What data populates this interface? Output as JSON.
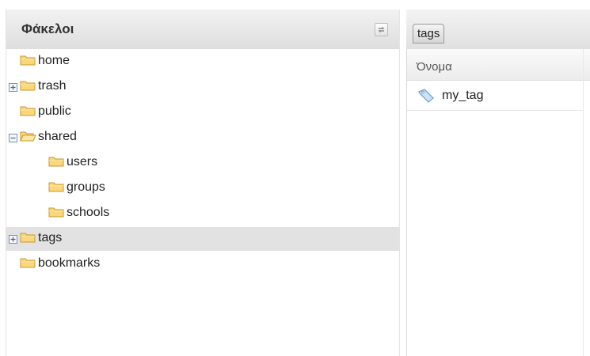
{
  "folders_panel": {
    "title": "Φάκελοι",
    "refresh_icon": "refresh-icon",
    "tree": [
      {
        "label": "home",
        "icon": "folder-icon",
        "expander": null,
        "depth": 0,
        "selected": false
      },
      {
        "label": "trash",
        "icon": "folder-icon",
        "expander": "expand",
        "depth": 0,
        "selected": false
      },
      {
        "label": "public",
        "icon": "folder-icon",
        "expander": null,
        "depth": 0,
        "selected": false
      },
      {
        "label": "shared",
        "icon": "folder-open-icon",
        "expander": "collapse",
        "depth": 0,
        "selected": false
      },
      {
        "label": "users",
        "icon": "folder-icon",
        "expander": null,
        "depth": 1,
        "selected": false
      },
      {
        "label": "groups",
        "icon": "folder-icon",
        "expander": null,
        "depth": 1,
        "selected": false
      },
      {
        "label": "schools",
        "icon": "folder-icon",
        "expander": null,
        "depth": 1,
        "selected": false
      },
      {
        "label": "tags",
        "icon": "folder-icon",
        "expander": "expand",
        "depth": 0,
        "selected": true
      },
      {
        "label": "bookmarks",
        "icon": "folder-icon",
        "expander": null,
        "depth": 0,
        "selected": false
      }
    ]
  },
  "tags_panel": {
    "tab_label": "tags",
    "column_header": "Όνομα",
    "items": [
      {
        "label": "my_tag",
        "icon": "tag-icon"
      }
    ]
  },
  "colors": {
    "folder_fill": "#f9d77a",
    "folder_stroke": "#c99a2e",
    "selected_row": "#e2e2e2",
    "tag_icon": "#6fa6d8"
  }
}
